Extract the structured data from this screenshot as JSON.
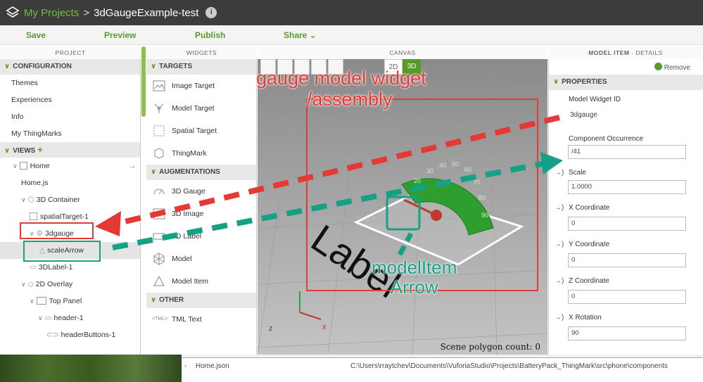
{
  "header": {
    "breadcrumb_root": "My Projects",
    "separator": ">",
    "project_name": "3dGaugeExample-test"
  },
  "toolbar": {
    "save": "Save",
    "preview": "Preview",
    "publish": "Publish",
    "share": "Share"
  },
  "panels": {
    "project": "PROJECT",
    "widgets": "WIDGETS",
    "canvas": "CANVAS",
    "details_title": "MODEL ITEM",
    "details_suffix": "- DETAILS"
  },
  "project": {
    "configuration": "CONFIGURATION",
    "config_items": [
      "Themes",
      "Experiences",
      "Info",
      "My ThingMarks"
    ],
    "views": "VIEWS",
    "tree": {
      "home": "Home",
      "homejs": "Home.js",
      "container3d": "3D Container",
      "spatial": "spatialTarget-1",
      "gauge": "3dgauge",
      "scale_arrow": "scaleArrow",
      "label": "3DLabel-1",
      "overlay": "2D Overlay",
      "top_panel": "Top Panel",
      "header1": "header-1",
      "header_buttons": "headerButtons-1"
    }
  },
  "widgets": {
    "targets": "TARGETS",
    "target_items": [
      "Image Target",
      "Model Target",
      "Spatial Target",
      "ThingMark"
    ],
    "augmentations": "AUGMENTATIONS",
    "aug_items": [
      "3D Gauge",
      "3D Image",
      "3D Label",
      "Model",
      "Model Item"
    ],
    "other": "OTHER",
    "other_items": [
      "TML Text"
    ]
  },
  "canvas": {
    "view_2d": "2D",
    "view_3d": "3D",
    "polygon_count": "Scene polygon count: 0",
    "label_text": "Label",
    "annotation_gauge_line1": "gauge model widget",
    "annotation_gauge_line2": "/assembly",
    "annotation_arrow_line1": "modelItem",
    "annotation_arrow_line2": "Arrow",
    "gauge_ticks": [
      "20",
      "30",
      "40",
      "50",
      "60",
      "70",
      "80",
      "90"
    ],
    "axis_x": "x",
    "axis_z": "z"
  },
  "details": {
    "remove": "Remove",
    "properties": "PROPERTIES",
    "model_widget_id_label": "Model Widget ID",
    "model_widget_id_value": "3dgauge",
    "component_label": "Component Occurrence",
    "component_value": "/41",
    "scale_label": "Scale",
    "scale_value": "1.0000",
    "x_label": "X Coordinate",
    "x_value": "0",
    "y_label": "Y Coordinate",
    "y_value": "0",
    "z_label": "Z Coordinate",
    "z_value": "0",
    "xrot_label": "X Rotation",
    "xrot_value": "90",
    "bind_glyph": "→)"
  },
  "bottom": {
    "file": "Home.json",
    "path": "C:\\Users\\rraytchev\\Documents\\VuforiaStudio\\Projects\\BatteryPack_ThingMark\\src\\phone\\components"
  },
  "colors": {
    "accent": "#5a9a2a",
    "annotation_red": "#e53935",
    "annotation_teal": "#16a085",
    "gauge_green": "#2e9e2e"
  }
}
